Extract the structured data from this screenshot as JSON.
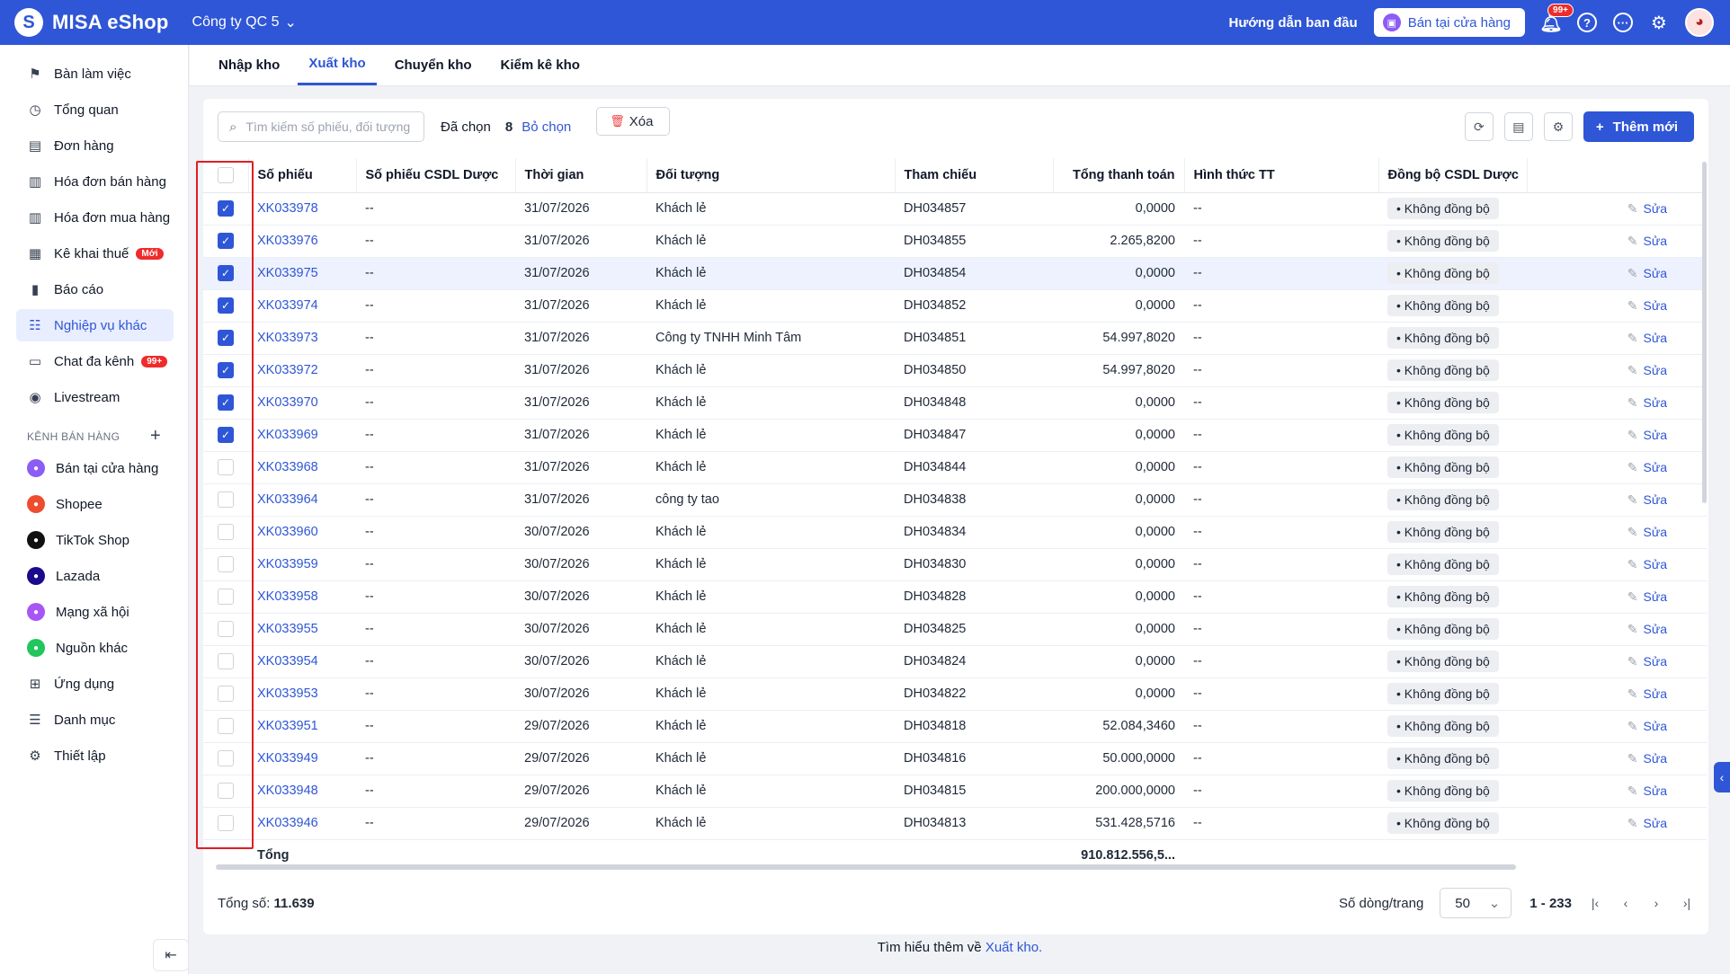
{
  "app": {
    "logo_letter": "S",
    "name": "MISA eShop",
    "company": "Công ty QC 5"
  },
  "topbar": {
    "guide": "Hướng dẫn ban đầu",
    "store_button": "Bán tại cửa hàng",
    "notif_badge": "99+"
  },
  "sidebar": {
    "items": [
      {
        "label": "Bàn làm việc",
        "icon": "flag-icon"
      },
      {
        "label": "Tổng quan",
        "icon": "gauge-icon"
      },
      {
        "label": "Đơn hàng",
        "icon": "receipt-icon"
      },
      {
        "label": "Hóa đơn bán hàng",
        "icon": "invoice-icon"
      },
      {
        "label": "Hóa đơn mua hàng",
        "icon": "invoice-icon"
      },
      {
        "label": "Kê khai thuế",
        "icon": "tax-icon",
        "badge": "Mới"
      },
      {
        "label": "Báo cáo",
        "icon": "chart-icon"
      },
      {
        "label": "Nghiệp vụ khác",
        "icon": "grid-list-icon",
        "active": true
      },
      {
        "label": "Chat đa kênh",
        "icon": "chat-icon",
        "badge": "99+"
      },
      {
        "label": "Livestream",
        "icon": "broadcast-icon"
      }
    ],
    "channels_title": "KÊNH BÁN HÀNG",
    "channels": [
      {
        "label": "Bán tại cửa hàng",
        "color": "#8b5cf6"
      },
      {
        "label": "Shopee",
        "color": "#ee4d2d"
      },
      {
        "label": "TikTok Shop",
        "color": "#111111"
      },
      {
        "label": "Lazada",
        "color": "#1a0a8c"
      },
      {
        "label": "Mạng xã hội",
        "color": "#a855f7"
      },
      {
        "label": "Nguồn khác",
        "color": "#22c55e"
      }
    ],
    "bottom_items": [
      {
        "label": "Ứng dụng",
        "icon": "apps-icon"
      },
      {
        "label": "Danh mục",
        "icon": "list-icon"
      },
      {
        "label": "Thiết lập",
        "icon": "gear-icon"
      }
    ]
  },
  "tabs": [
    {
      "label": "Nhập kho",
      "active": false
    },
    {
      "label": "Xuất kho",
      "active": true
    },
    {
      "label": "Chuyển kho",
      "active": false
    },
    {
      "label": "Kiểm kê kho",
      "active": false
    }
  ],
  "toolbar": {
    "search_placeholder": "Tìm kiếm số phiếu, đối tượng",
    "selected_label": "Đã chọn",
    "selected_count": "8",
    "clear_label": "Bỏ chọn",
    "delete_label": "Xóa",
    "add_label": "Thêm mới"
  },
  "table": {
    "columns": [
      "Số phiếu",
      "Số phiếu CSDL Dược",
      "Thời gian",
      "Đối tượng",
      "Tham chiếu",
      "Tổng thanh toán",
      "Hình thức TT",
      "Đồng bộ CSDL Dược"
    ],
    "edit_label": "Sửa",
    "rows": [
      {
        "checked": true,
        "code": "XK033978",
        "csdl": "--",
        "date": "31/07/2026",
        "party": "Khách lẻ",
        "ref": "DH034857",
        "total": "0,0000",
        "pay": "--",
        "sync": "Không đồng bộ"
      },
      {
        "checked": true,
        "code": "XK033976",
        "csdl": "--",
        "date": "31/07/2026",
        "party": "Khách lẻ",
        "ref": "DH034855",
        "total": "2.265,8200",
        "pay": "--",
        "sync": "Không đồng bộ"
      },
      {
        "checked": true,
        "code": "XK033975",
        "csdl": "--",
        "date": "31/07/2026",
        "party": "Khách lẻ",
        "ref": "DH034854",
        "total": "0,0000",
        "pay": "--",
        "sync": "Không đồng bộ",
        "highlight": true
      },
      {
        "checked": true,
        "code": "XK033974",
        "csdl": "--",
        "date": "31/07/2026",
        "party": "Khách lẻ",
        "ref": "DH034852",
        "total": "0,0000",
        "pay": "--",
        "sync": "Không đồng bộ"
      },
      {
        "checked": true,
        "code": "XK033973",
        "csdl": "--",
        "date": "31/07/2026",
        "party": "Công ty TNHH Minh Tâm",
        "ref": "DH034851",
        "total": "54.997,8020",
        "pay": "--",
        "sync": "Không đồng bộ"
      },
      {
        "checked": true,
        "code": "XK033972",
        "csdl": "--",
        "date": "31/07/2026",
        "party": "Khách lẻ",
        "ref": "DH034850",
        "total": "54.997,8020",
        "pay": "--",
        "sync": "Không đồng bộ"
      },
      {
        "checked": true,
        "code": "XK033970",
        "csdl": "--",
        "date": "31/07/2026",
        "party": "Khách lẻ",
        "ref": "DH034848",
        "total": "0,0000",
        "pay": "--",
        "sync": "Không đồng bộ"
      },
      {
        "checked": true,
        "code": "XK033969",
        "csdl": "--",
        "date": "31/07/2026",
        "party": "Khách lẻ",
        "ref": "DH034847",
        "total": "0,0000",
        "pay": "--",
        "sync": "Không đồng bộ"
      },
      {
        "checked": false,
        "code": "XK033968",
        "csdl": "--",
        "date": "31/07/2026",
        "party": "Khách lẻ",
        "ref": "DH034844",
        "total": "0,0000",
        "pay": "--",
        "sync": "Không đồng bộ"
      },
      {
        "checked": false,
        "code": "XK033964",
        "csdl": "--",
        "date": "31/07/2026",
        "party": "công ty tao",
        "ref": "DH034838",
        "total": "0,0000",
        "pay": "--",
        "sync": "Không đồng bộ"
      },
      {
        "checked": false,
        "code": "XK033960",
        "csdl": "--",
        "date": "30/07/2026",
        "party": "Khách lẻ",
        "ref": "DH034834",
        "total": "0,0000",
        "pay": "--",
        "sync": "Không đồng bộ"
      },
      {
        "checked": false,
        "code": "XK033959",
        "csdl": "--",
        "date": "30/07/2026",
        "party": "Khách lẻ",
        "ref": "DH034830",
        "total": "0,0000",
        "pay": "--",
        "sync": "Không đồng bộ"
      },
      {
        "checked": false,
        "code": "XK033958",
        "csdl": "--",
        "date": "30/07/2026",
        "party": "Khách lẻ",
        "ref": "DH034828",
        "total": "0,0000",
        "pay": "--",
        "sync": "Không đồng bộ"
      },
      {
        "checked": false,
        "code": "XK033955",
        "csdl": "--",
        "date": "30/07/2026",
        "party": "Khách lẻ",
        "ref": "DH034825",
        "total": "0,0000",
        "pay": "--",
        "sync": "Không đồng bộ"
      },
      {
        "checked": false,
        "code": "XK033954",
        "csdl": "--",
        "date": "30/07/2026",
        "party": "Khách lẻ",
        "ref": "DH034824",
        "total": "0,0000",
        "pay": "--",
        "sync": "Không đồng bộ"
      },
      {
        "checked": false,
        "code": "XK033953",
        "csdl": "--",
        "date": "30/07/2026",
        "party": "Khách lẻ",
        "ref": "DH034822",
        "total": "0,0000",
        "pay": "--",
        "sync": "Không đồng bộ"
      },
      {
        "checked": false,
        "code": "XK033951",
        "csdl": "--",
        "date": "29/07/2026",
        "party": "Khách lẻ",
        "ref": "DH034818",
        "total": "52.084,3460",
        "pay": "--",
        "sync": "Không đồng bộ"
      },
      {
        "checked": false,
        "code": "XK033949",
        "csdl": "--",
        "date": "29/07/2026",
        "party": "Khách lẻ",
        "ref": "DH034816",
        "total": "50.000,0000",
        "pay": "--",
        "sync": "Không đồng bộ"
      },
      {
        "checked": false,
        "code": "XK033948",
        "csdl": "--",
        "date": "29/07/2026",
        "party": "Khách lẻ",
        "ref": "DH034815",
        "total": "200.000,0000",
        "pay": "--",
        "sync": "Không đồng bộ"
      },
      {
        "checked": false,
        "code": "XK033946",
        "csdl": "--",
        "date": "29/07/2026",
        "party": "Khách lẻ",
        "ref": "DH034813",
        "total": "531.428,5716",
        "pay": "--",
        "sync": "Không đồng bộ"
      }
    ],
    "total_label": "Tổng",
    "total_value": "910.812.556,5..."
  },
  "footer": {
    "total_label": "Tổng số:",
    "total_count": "11.639",
    "rows_per_page_label": "Số dòng/trang",
    "rows_per_page": "50",
    "range": "1 - 233"
  },
  "learn_more": {
    "text": "Tìm hiểu thêm về",
    "link": "Xuất kho."
  },
  "colors": {
    "primary": "#2f56d6",
    "highlight_box": "#e11d24"
  }
}
